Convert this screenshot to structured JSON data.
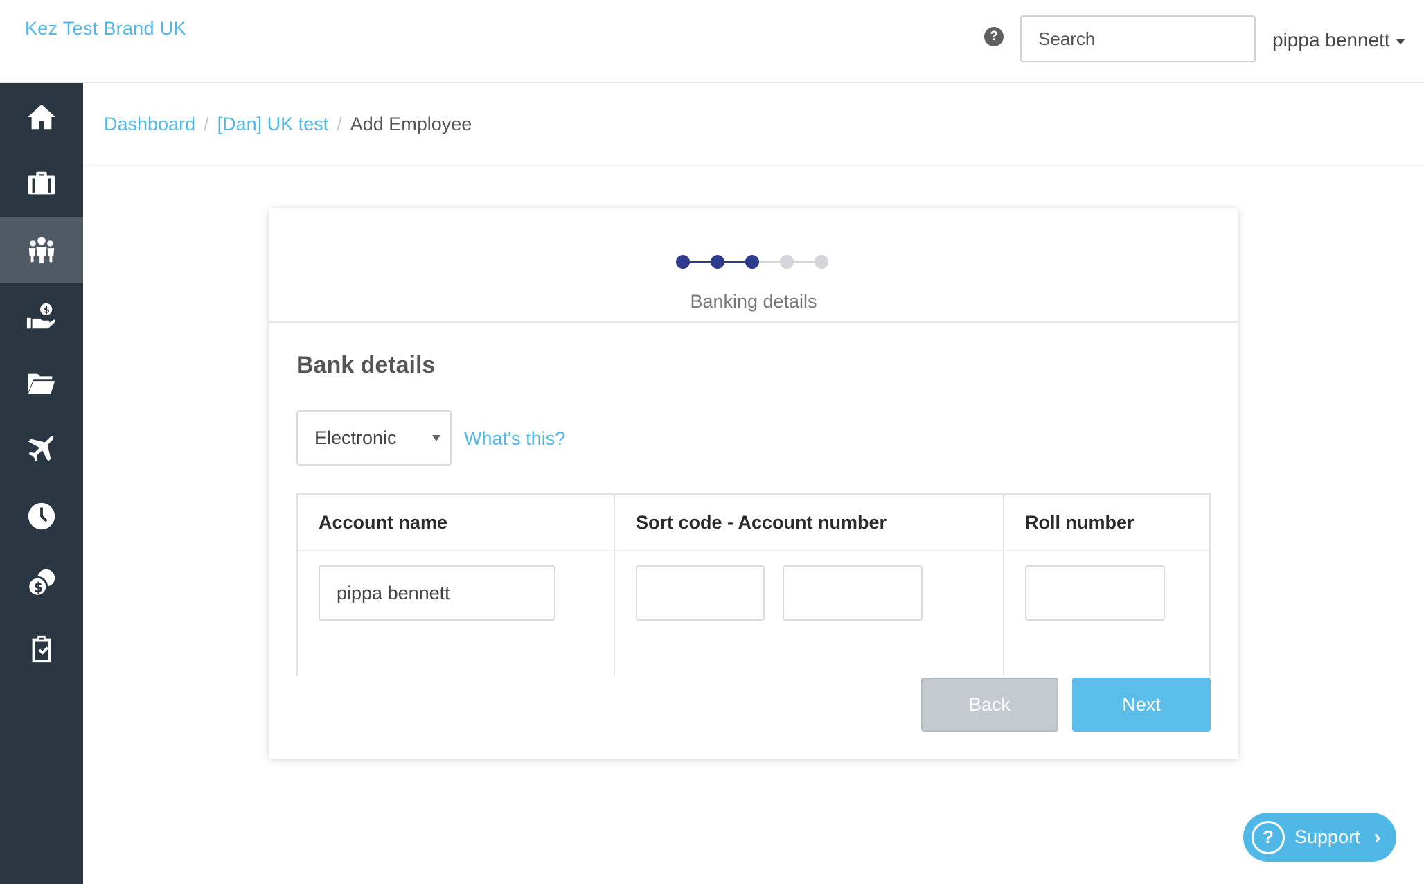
{
  "header": {
    "brand": "Kez Test Brand UK",
    "help_icon": "?",
    "search_placeholder": "Search",
    "user_name": "pippa bennett"
  },
  "sidebar": {
    "items": [
      {
        "icon": "home-icon",
        "active": false
      },
      {
        "icon": "briefcase-icon",
        "active": false
      },
      {
        "icon": "employees-icon",
        "active": true
      },
      {
        "icon": "hand-money-icon",
        "active": false
      },
      {
        "icon": "folder-icon",
        "active": false
      },
      {
        "icon": "plane-icon",
        "active": false
      },
      {
        "icon": "clock-icon",
        "active": false
      },
      {
        "icon": "coins-icon",
        "active": false
      },
      {
        "icon": "clipboard-check-icon",
        "active": false
      }
    ]
  },
  "breadcrumb": {
    "items": [
      "Dashboard",
      "[Dan] UK test"
    ],
    "current": "Add Employee",
    "separator": "/"
  },
  "wizard": {
    "steps_total": 5,
    "steps_completed": 3,
    "step_label": "Banking details",
    "active_color": "#2e3a8c",
    "inactive_color": "#d3d5d8"
  },
  "form": {
    "section_title": "Bank details",
    "payment_method": "Electronic",
    "whats_this": "What's this?",
    "columns": [
      "Account name",
      "Sort code - Account number",
      "Roll number"
    ],
    "account_name_value": "pippa bennett",
    "sort_code_value": "",
    "account_number_value": "",
    "roll_number_value": ""
  },
  "buttons": {
    "back": "Back",
    "next": "Next"
  },
  "support": {
    "icon": "?",
    "label": "Support",
    "chevron": "›"
  },
  "colors": {
    "accent": "#4fb8e6",
    "sidebar": "#2a3641"
  }
}
